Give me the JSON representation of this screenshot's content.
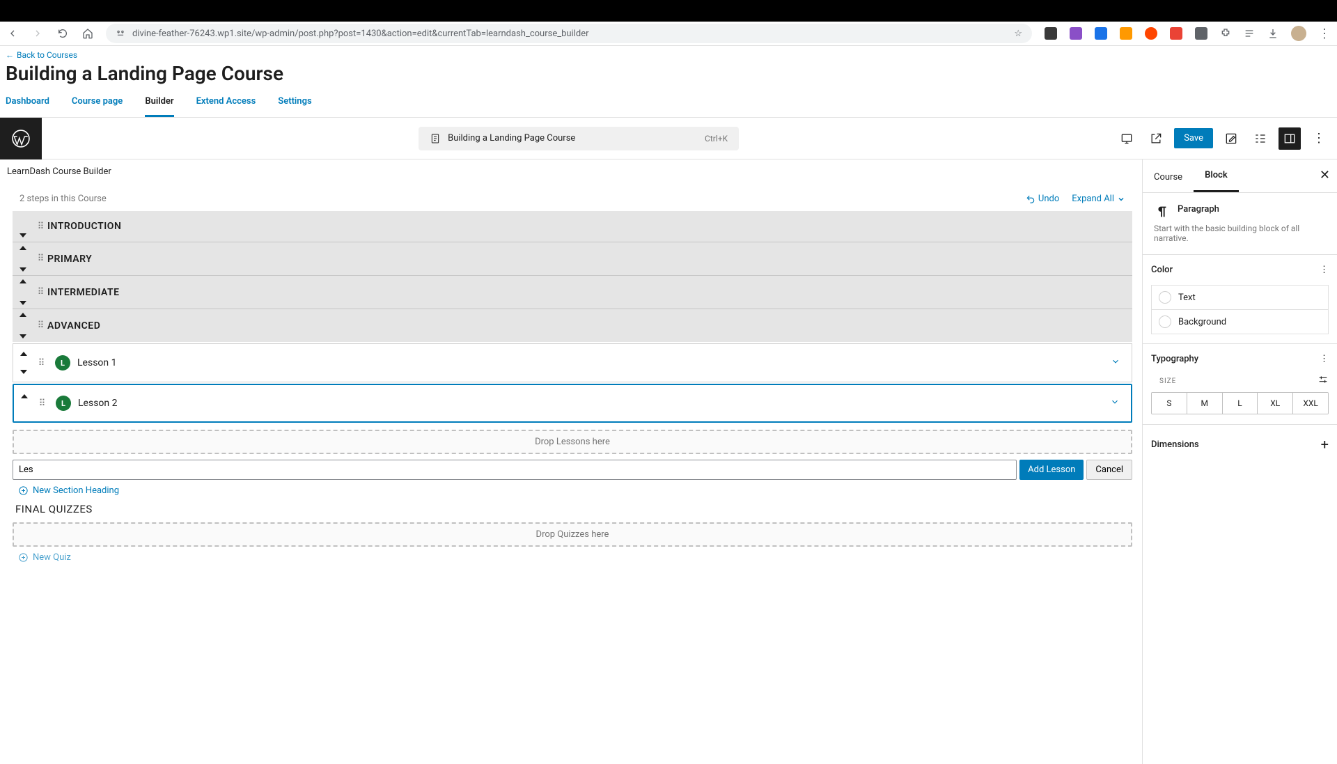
{
  "browser": {
    "url": "divine-feather-76243.wp1.site/wp-admin/post.php?post=1430&action=edit&currentTab=learndash_course_builder"
  },
  "header": {
    "back_link": "Back to Courses",
    "title": "Building a Landing Page Course"
  },
  "tabs": [
    "Dashboard",
    "Course page",
    "Builder",
    "Extend Access",
    "Settings"
  ],
  "active_tab": "Builder",
  "wp_bar": {
    "doc_title": "Building a Landing Page Course",
    "kbd": "Ctrl+K",
    "save": "Save"
  },
  "builder": {
    "label": "LearnDash Course Builder",
    "steps": "2 steps in this Course",
    "undo": "Undo",
    "expand": "Expand All",
    "sections": [
      "INTRODUCTION",
      "PRIMARY",
      "INTERMEDIATE",
      "ADVANCED"
    ],
    "lessons": [
      {
        "badge": "L",
        "title": "Lesson 1"
      },
      {
        "badge": "L",
        "title": "Lesson 2"
      }
    ],
    "drop_lessons": "Drop Lessons here",
    "add_input_value": "Les",
    "add_lesson_btn": "Add Lesson",
    "cancel_btn": "Cancel",
    "new_section": "New Section Heading",
    "final_quizzes": "FINAL QUIZZES",
    "drop_quizzes": "Drop Quizzes here",
    "new_quiz": "New Quiz"
  },
  "sidebar": {
    "tabs": [
      "Course",
      "Block"
    ],
    "active_tab": "Block",
    "block_name": "Paragraph",
    "block_desc": "Start with the basic building block of all narrative.",
    "color_label": "Color",
    "color_opts": [
      "Text",
      "Background"
    ],
    "typo_label": "Typography",
    "size_label": "SIZE",
    "sizes": [
      "S",
      "M",
      "L",
      "XL",
      "XXL"
    ],
    "dim_label": "Dimensions"
  }
}
